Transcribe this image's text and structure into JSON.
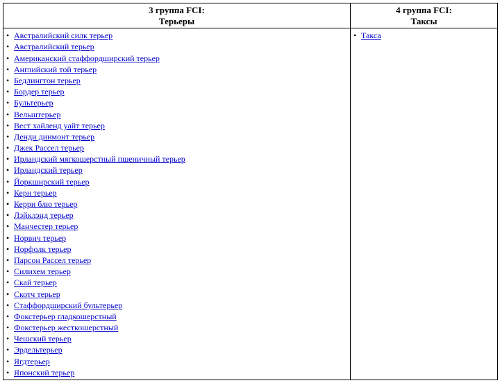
{
  "columns": [
    {
      "header_line1": "3 группа FCI:",
      "header_line2": "Терьеры",
      "items": [
        "Австралийский силк терьер",
        "Австралийский терьер",
        "Американский стаффордширский терьер",
        "Английский той терьер",
        "Бедлингтон терьер",
        "Бордер терьер",
        "Бультерьер",
        "Вельштерьер",
        "Вест хайленд уайт терьер",
        "Денди динмонт терьер",
        "Джек Рассел терьер",
        "Ирландский мягкошерстный пшеничный терьер",
        "Ирландский терьер",
        "Йоркширский терьер",
        "Керн терьер",
        "Керри блю терьер",
        "Лэйклэнд терьер",
        "Манчестер терьер",
        "Норвич терьер",
        "Норфолк терьер",
        "Парсон Рассел терьер",
        "Силихем терьер",
        "Скай терьер",
        "Скотч терьер",
        "Стаффордширский бультерьер",
        "Фокстерьер гладкошерстный",
        "Фокстерьер жесткошерстный",
        "Чешский терьер",
        "Эрдельтерьер",
        "Ягдтерьер",
        "Японский терьер"
      ]
    },
    {
      "header_line1": "4 группа FCI:",
      "header_line2": "Таксы",
      "items": [
        "Такса"
      ]
    }
  ]
}
